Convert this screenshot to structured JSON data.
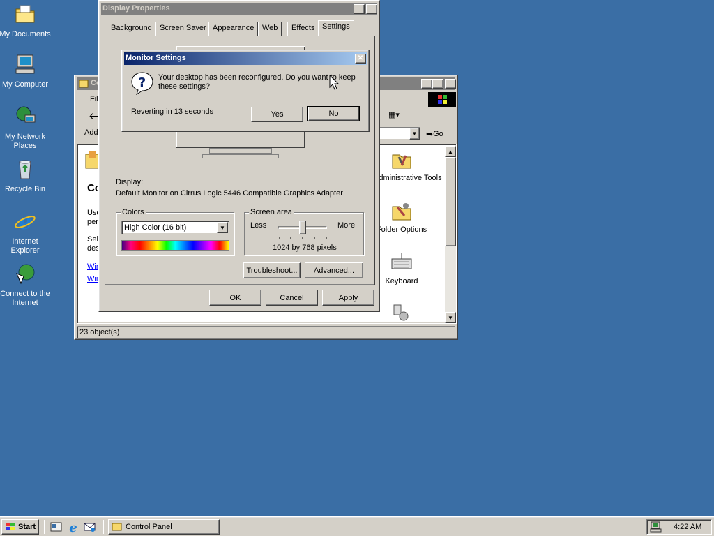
{
  "desktop": {
    "icons": [
      {
        "label": "My Documents",
        "icon": "folder-documents-icon"
      },
      {
        "label": "My Computer",
        "icon": "computer-icon"
      },
      {
        "label": "My Network Places",
        "icon": "network-icon"
      },
      {
        "label": "Recycle Bin",
        "icon": "recycle-bin-icon"
      },
      {
        "label": "Internet Explorer",
        "icon": "internet-explorer-icon"
      },
      {
        "label": "Connect to the Internet",
        "icon": "connect-internet-icon"
      }
    ],
    "background_color": "#3a6ea5"
  },
  "control_panel": {
    "title": "Co",
    "menu_file": "File",
    "address_label": "Addr",
    "go_label": "Go",
    "left_title": "Co",
    "left_text1": "Use",
    "left_text2": "pers",
    "left_text3": "Sele",
    "left_text4": "des",
    "left_link1": "Win",
    "left_link2": "Win",
    "items": {
      "admin_tools": "Administrative Tools",
      "folder_options": "Folder Options",
      "keyboard": "Keyboard"
    },
    "status": "23 object(s)"
  },
  "display_properties": {
    "title": "Display Properties",
    "help": "?",
    "close": "✕",
    "tabs": [
      "Background",
      "Screen Saver",
      "Appearance",
      "Web",
      "Effects",
      "Settings"
    ],
    "display_label": "Display:",
    "display_value": "Default Monitor on Cirrus Logic 5446 Compatible Graphics Adapter",
    "colors_label": "Colors",
    "colors_value": "High Color (16 bit)",
    "screen_area_label": "Screen area",
    "less": "Less",
    "more": "More",
    "resolution": "1024 by 768 pixels",
    "troubleshoot": "Troubleshoot...",
    "advanced": "Advanced...",
    "ok": "OK",
    "cancel": "Cancel",
    "apply": "Apply"
  },
  "monitor_settings": {
    "title": "Monitor Settings",
    "close": "✕",
    "message": "Your desktop has been reconfigured.  Do you want to keep these settings?",
    "reverting": "Reverting in 13 seconds",
    "yes": "Yes",
    "no": "No"
  },
  "taskbar": {
    "start": "Start",
    "task": "Control Panel",
    "clock": "4:22 AM"
  }
}
